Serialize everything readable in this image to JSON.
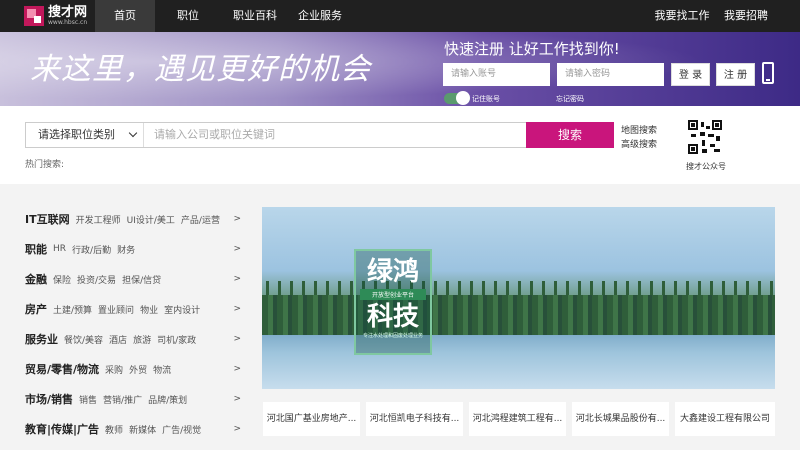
{
  "brand": {
    "name": "搜才网",
    "url": "www.hbsc.cn",
    "accent_color": "#c9157c"
  },
  "nav": {
    "items": [
      {
        "label": "首页",
        "active": true
      },
      {
        "label": "职位",
        "active": false
      },
      {
        "label": "职业百科",
        "active": false
      },
      {
        "label": "企业服务",
        "active": false
      }
    ],
    "right": [
      {
        "label": "我要找工作"
      },
      {
        "label": "我要招聘"
      }
    ]
  },
  "banner": {
    "slogan": "来这里，遇见更好的机会",
    "register_title": "快速注册 让好工作找到你!",
    "account_placeholder": "请输入账号",
    "password_placeholder": "请输入密码",
    "login_label": "登 录",
    "register_label": "注 册",
    "remember_label": "记住账号",
    "forgot_label": "忘记密码",
    "phone_icon": "phone-icon"
  },
  "search": {
    "category_label": "请选择职位类别",
    "placeholder": "请输入公司或职位关键词",
    "button_label": "搜索",
    "map_search": "地图搜索",
    "advanced_search": "高级搜索",
    "hot_label": "热门搜索:",
    "qr_label": "搜才公众号"
  },
  "categories": [
    {
      "title": "IT互联网",
      "subs": [
        "开发工程师",
        "UI设计/美工",
        "产品/运营"
      ],
      "arrow": ">"
    },
    {
      "title": "职能",
      "subs": [
        "HR",
        "行政/后勤",
        "财务"
      ],
      "arrow": ">"
    },
    {
      "title": "金融",
      "subs": [
        "保险",
        "投资/交易",
        "担保/信贷"
      ],
      "arrow": ">"
    },
    {
      "title": "房产",
      "subs": [
        "土建/预算",
        "置业顾问",
        "物业",
        "室内设计"
      ],
      "arrow": ">"
    },
    {
      "title": "服务业",
      "subs": [
        "餐饮/美容",
        "酒店",
        "旅游",
        "司机/家政"
      ],
      "arrow": ">"
    },
    {
      "title": "贸易/零售/物流",
      "subs": [
        "采购",
        "外贸",
        "物流"
      ],
      "arrow": ">"
    },
    {
      "title": "市场/销售",
      "subs": [
        "销售",
        "营销/推广",
        "品牌/策划"
      ],
      "arrow": ">"
    },
    {
      "title": "教育|传媒|广告",
      "subs": [
        "教师",
        "新媒体",
        "广告/视觉"
      ],
      "arrow": ">"
    }
  ],
  "promo": {
    "title_top": "绿鸿",
    "subtitle": "开放型创业平台",
    "title_bottom": "科技",
    "tagline": "专注水处理和固废处理业务"
  },
  "companies": [
    "河北国广基业房地产...",
    "河北恒凯电子科技有...",
    "河北鸿程建筑工程有...",
    "河北长城果品股份有...",
    "大鑫建设工程有限公司"
  ]
}
